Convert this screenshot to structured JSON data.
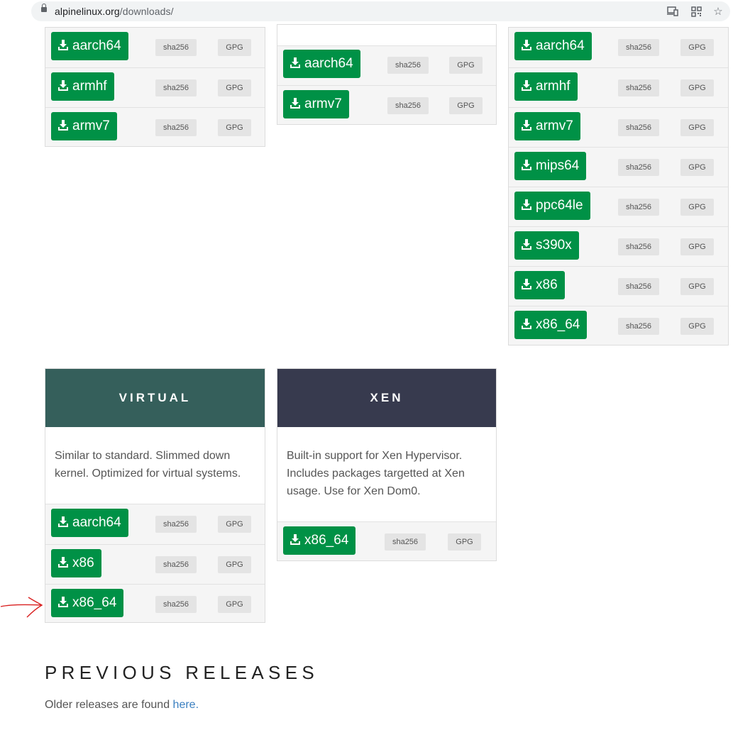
{
  "browser": {
    "url_host": "alpinelinux.org",
    "url_path": "/downloads/",
    "icons": [
      "lock-icon",
      "cast-icon",
      "qr-code-icon",
      "bookmark-star-icon"
    ]
  },
  "labels": {
    "sha": "sha256",
    "gpg": "GPG"
  },
  "colors": {
    "download_green": "#009146",
    "virtual_header": "#355f5b",
    "xen_header": "#373a4e",
    "link_blue": "#3a7fc0",
    "annotation_red": "#d92020"
  },
  "box_left": {
    "items": [
      "aarch64",
      "armhf",
      "armv7"
    ]
  },
  "box_middle": {
    "items": [
      "aarch64",
      "armv7"
    ]
  },
  "box_right": {
    "items": [
      "aarch64",
      "armhf",
      "armv7",
      "mips64",
      "ppc64le",
      "s390x",
      "x86",
      "x86_64"
    ]
  },
  "virtual": {
    "title": "VIRTUAL",
    "description": "Similar to standard. Slimmed down kernel. Optimized for virtual systems.",
    "items": [
      "aarch64",
      "x86",
      "x86_64"
    ]
  },
  "xen": {
    "title": "XEN",
    "description": "Built-in support for Xen Hypervisor. Includes packages targetted at Xen usage. Use for Xen Dom0.",
    "items": [
      "x86_64"
    ]
  },
  "previous": {
    "title": "PREVIOUS RELEASES",
    "text": "Older releases are found ",
    "link": "here."
  }
}
